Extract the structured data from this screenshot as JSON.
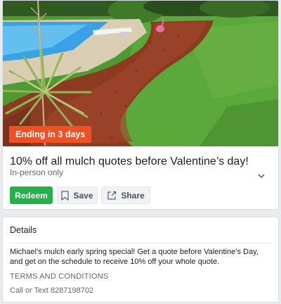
{
  "offer": {
    "badge": "Ending in 3 days",
    "title": "10% off all mulch quotes before Valentine’s day!",
    "subtitle": "In-person only",
    "actions": {
      "redeem": "Redeem",
      "save": "Save",
      "share": "Share"
    }
  },
  "details": {
    "heading": "Details",
    "description": "Michael’s mulch early spring special! Get a quote before Valentine’s Day, and get on the schedule to receive 10% off your whole quote.",
    "terms_heading": "TERMS AND CONDITIONS",
    "terms_text": "Call or Text 8287198702"
  },
  "colors": {
    "badge": "#f25022",
    "redeem": "#24b04b",
    "page_bg": "#e9ebee"
  },
  "icons": {
    "save": "bookmark-icon",
    "share": "share-icon",
    "expand": "chevron-down-icon"
  }
}
